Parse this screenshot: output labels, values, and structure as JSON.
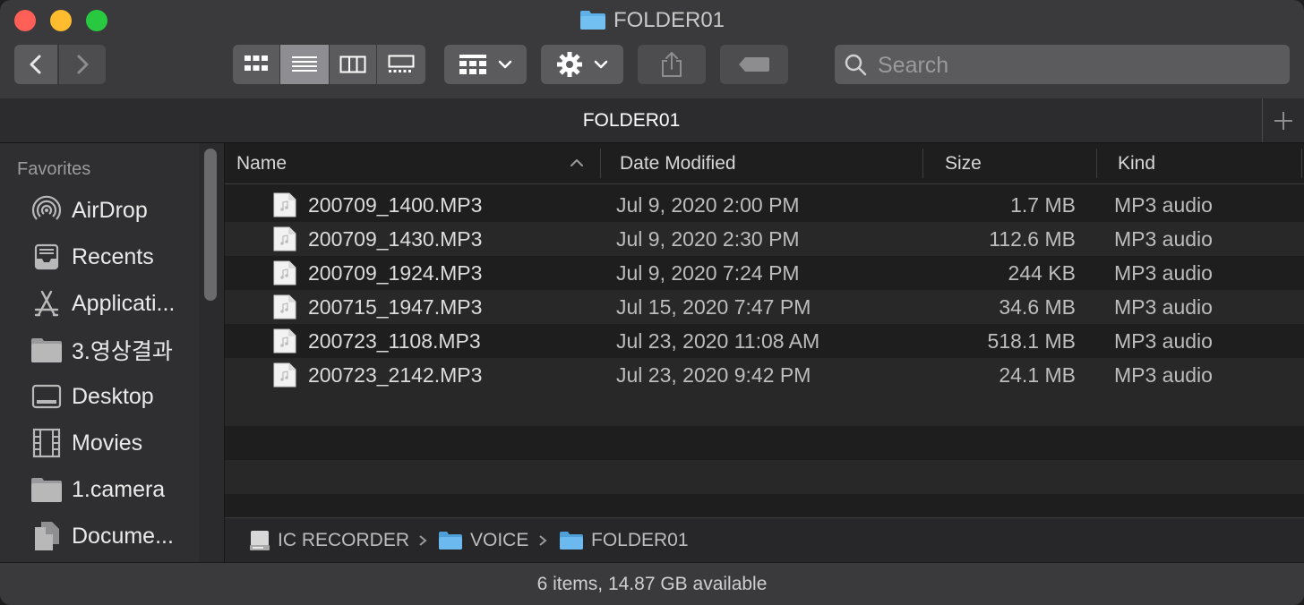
{
  "window": {
    "title": "FOLDER01"
  },
  "toolbar": {
    "back_icon": "chevron-left-icon",
    "forward_icon": "chevron-right-icon",
    "view_modes": [
      "icon-view-icon",
      "list-view-icon",
      "column-view-icon",
      "gallery-view-icon"
    ],
    "active_view": "list-view-icon",
    "group_icon": "group-by-icon",
    "action_icon": "gear-icon",
    "share_icon": "share-icon",
    "tag_icon": "tag-icon",
    "search_placeholder": "Search"
  },
  "tabbar": {
    "title": "FOLDER01",
    "add_icon": "plus-icon"
  },
  "sidebar": {
    "header": "Favorites",
    "items": [
      {
        "label": "AirDrop",
        "icon": "airdrop-icon"
      },
      {
        "label": "Recents",
        "icon": "recents-icon"
      },
      {
        "label": "Applicati...",
        "icon": "applications-icon"
      },
      {
        "label": "3.영상결과",
        "icon": "folder-icon"
      },
      {
        "label": "Desktop",
        "icon": "desktop-icon"
      },
      {
        "label": "Movies",
        "icon": "movies-icon"
      },
      {
        "label": "1.camera",
        "icon": "folder-icon"
      },
      {
        "label": "Docume...",
        "icon": "documents-icon"
      }
    ]
  },
  "list": {
    "columns": {
      "name": "Name",
      "date": "Date Modified",
      "size": "Size",
      "kind": "Kind"
    },
    "sort_icon": "chevron-up-icon",
    "rows": [
      {
        "name": "200709_1400.MP3",
        "date": "Jul 9, 2020 2:00 PM",
        "size": "1.7 MB",
        "kind": "MP3 audio"
      },
      {
        "name": "200709_1430.MP3",
        "date": "Jul 9, 2020 2:30 PM",
        "size": "112.6 MB",
        "kind": "MP3 audio"
      },
      {
        "name": "200709_1924.MP3",
        "date": "Jul 9, 2020 7:24 PM",
        "size": "244 KB",
        "kind": "MP3 audio"
      },
      {
        "name": "200715_1947.MP3",
        "date": "Jul 15, 2020 7:47 PM",
        "size": "34.6 MB",
        "kind": "MP3 audio"
      },
      {
        "name": "200723_1108.MP3",
        "date": "Jul 23, 2020 11:08 AM",
        "size": "518.1 MB",
        "kind": "MP3 audio"
      },
      {
        "name": "200723_2142.MP3",
        "date": "Jul 23, 2020 9:42 PM",
        "size": "24.1 MB",
        "kind": "MP3 audio"
      }
    ]
  },
  "pathbar": {
    "crumbs": [
      {
        "label": "IC RECORDER",
        "icon": "drive-icon"
      },
      {
        "label": "VOICE",
        "icon": "folder-icon"
      },
      {
        "label": "FOLDER01",
        "icon": "folder-icon"
      }
    ]
  },
  "status": {
    "text": "6 items, 14.87 GB available"
  },
  "colors": {
    "accent_folder": "#5fb0e8",
    "close": "#fe5f57",
    "minimize": "#febc2e",
    "maximize": "#28c840"
  }
}
